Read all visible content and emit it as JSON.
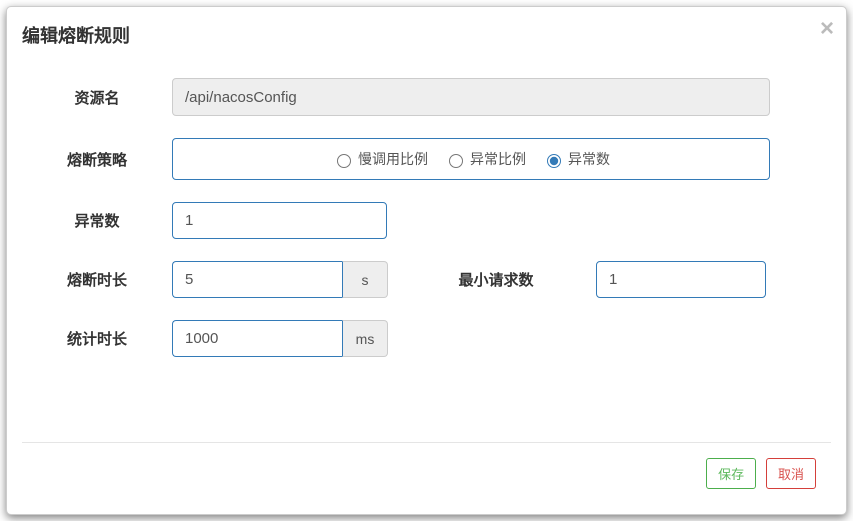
{
  "modal": {
    "title": "编辑熔断规则",
    "labels": {
      "resource": "资源名",
      "strategy": "熔断策略",
      "count": "异常数",
      "timeWindow": "熔断时长",
      "minRequest": "最小请求数",
      "statInterval": "统计时长"
    },
    "values": {
      "resource": "/api/nacosConfig",
      "count": "1",
      "timeWindow": "5",
      "minRequest": "1",
      "statInterval": "1000"
    },
    "units": {
      "seconds": "s",
      "milliseconds": "ms"
    },
    "strategies": {
      "slowRatio": "慢调用比例",
      "errorRatio": "异常比例",
      "errorCount": "异常数",
      "selected": "errorCount"
    },
    "buttons": {
      "save": "保存",
      "cancel": "取消"
    }
  }
}
